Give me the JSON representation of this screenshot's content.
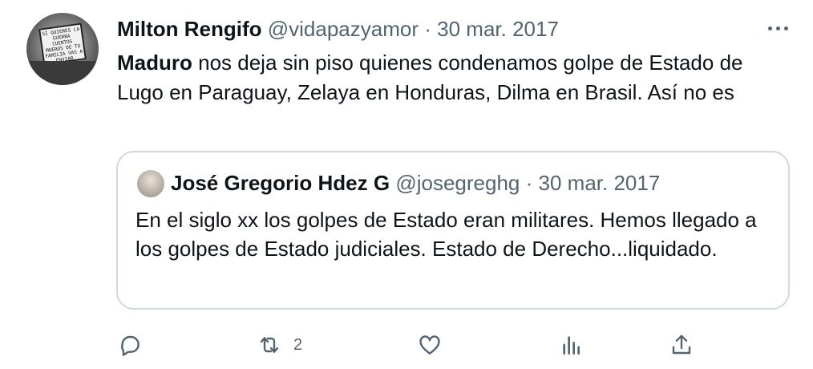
{
  "tweet": {
    "author_name": "Milton Rengifo",
    "handle": "@vidapazyamor",
    "separator": "·",
    "date": "30 mar. 2017",
    "text_bold": "Maduro",
    "text_rest": " nos deja sin piso quienes condenamos golpe de Estado de Lugo en Paraguay, Zelaya en Honduras, Dilma en Brasil. Así no es",
    "avatar_sign_text": "SI QUIERES LA GUERRA CUENTOS MUEROS DE TU FAMILIA VAS A ENVIAR"
  },
  "quote": {
    "author_name": "José Gregorio Hdez G",
    "handle": "@josegreghg",
    "separator": "·",
    "date": "30 mar. 2017",
    "text": "En el siglo xx los golpes de Estado eran militares. Hemos llegado a los golpes de Estado judiciales. Estado de Derecho...liquidado."
  },
  "actions": {
    "reply_icon": "reply-icon",
    "retweet_icon": "retweet-icon",
    "retweet_count": "2",
    "like_icon": "like-icon",
    "views_icon": "views-icon",
    "share_icon": "share-icon"
  },
  "colors": {
    "text": "#0f1419",
    "secondary": "#536471",
    "border": "#cfd9de"
  }
}
